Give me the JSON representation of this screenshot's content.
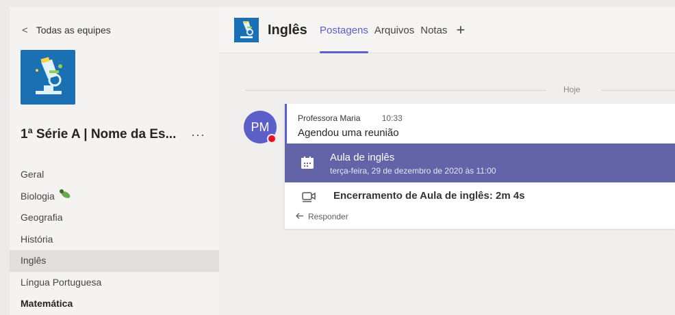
{
  "sidebar": {
    "back_label": "Todas as equipes",
    "team_name": "1ª Série A | Nome da Es...",
    "more_label": "···",
    "channels": [
      {
        "label": "Geral"
      },
      {
        "label": "Biologia",
        "emoji": "🐛"
      },
      {
        "label": "Geografia"
      },
      {
        "label": "História"
      },
      {
        "label": "Inglês",
        "active": true
      },
      {
        "label": "Língua Portuguesa"
      },
      {
        "label": "Matemática",
        "bold": true
      }
    ]
  },
  "header": {
    "channel_title": "Inglês",
    "tabs": [
      {
        "label": "Postagens",
        "active": true
      },
      {
        "label": "Arquivos"
      },
      {
        "label": "Notas"
      }
    ],
    "add_tab": "+"
  },
  "feed": {
    "date_label": "Hoje",
    "post": {
      "avatar_initials": "PM",
      "author": "Professora Maria",
      "time": "10:33",
      "message": "Agendou uma reunião",
      "meeting": {
        "title": "Aula de inglês",
        "date": "terça-feira, 29 de dezembro de 2020 às 11:00"
      },
      "ended_text": "Encerramento de Aula de inglês: 2m 4s",
      "reply_label": "Responder"
    }
  },
  "colors": {
    "accent": "#5b5fc7",
    "meeting_bg": "#6264a7",
    "team_logo_bg": "#1b6fb3",
    "presence_busy": "#e81123"
  }
}
